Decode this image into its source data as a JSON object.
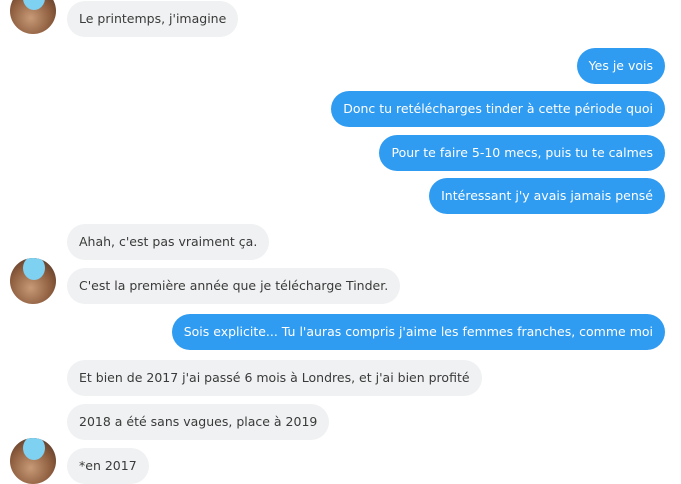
{
  "conversation": {
    "messages": [
      {
        "side": "in",
        "text": "Le printemps, j'imagine"
      },
      {
        "side": "out",
        "text": "Yes je vois"
      },
      {
        "side": "out",
        "text": "Donc tu retélécharges tinder à cette période quoi"
      },
      {
        "side": "out",
        "text": "Pour te faire 5-10 mecs, puis tu te calmes"
      },
      {
        "side": "out",
        "text": "Intéressant j'y avais jamais pensé"
      },
      {
        "side": "in",
        "text": "Ahah, c'est pas vraiment ça."
      },
      {
        "side": "in",
        "text": "C'est la première année que je télécharge Tinder."
      },
      {
        "side": "out",
        "text": "Sois explicite... Tu l'auras compris j'aime les femmes franches, comme moi"
      },
      {
        "side": "in",
        "text": "Et bien de 2017 j'ai passé 6 mois à Londres, et j'ai bien profité"
      },
      {
        "side": "in",
        "text": "2018 a été sans vagues, place à 2019"
      },
      {
        "side": "in",
        "text": "*en 2017"
      }
    ]
  },
  "colors": {
    "incoming_bubble": "#f0f1f2",
    "outgoing_bubble": "#2f9bf1",
    "avatar_overlay": "#7fd1f2"
  }
}
